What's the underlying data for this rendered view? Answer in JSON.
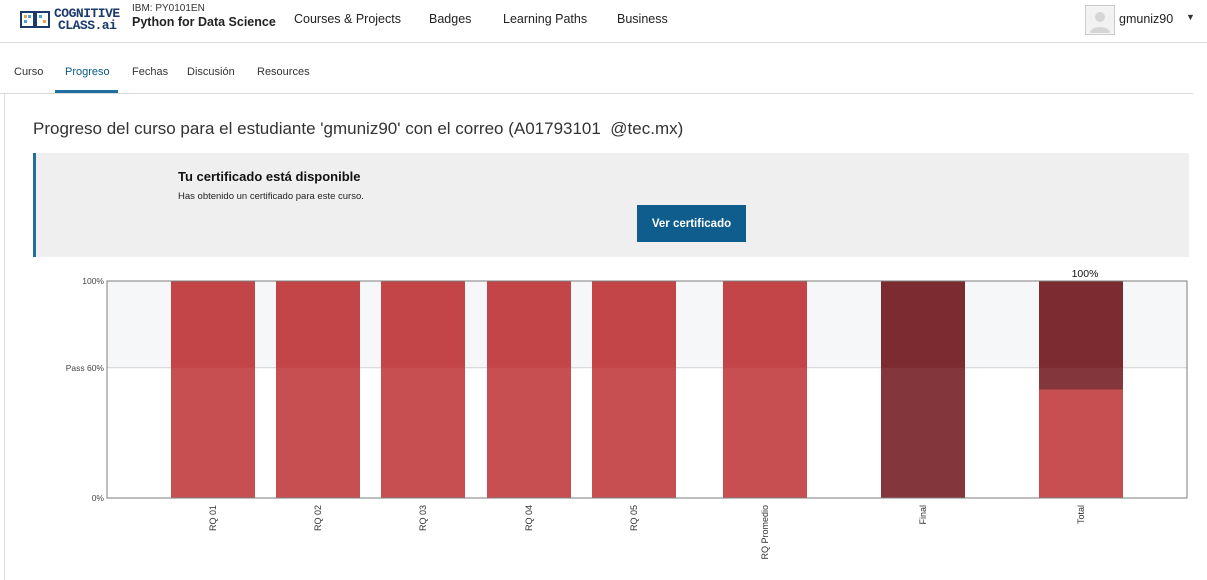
{
  "header": {
    "logo_line1": "COGNITIVE",
    "logo_line2": "CLASS.ai",
    "course_code": "IBM: PY0101EN",
    "course_name": "Python for Data Science",
    "nav": [
      "Courses & Projects",
      "Badges",
      "Learning Paths",
      "Business"
    ],
    "user": "gmuniz90"
  },
  "tabs": [
    "Curso",
    "Progreso",
    "Fechas",
    "Discusión",
    "Resources"
  ],
  "active_tab": "Progreso",
  "page_title": "Progreso del curso para el estudiante 'gmuniz90' con el correo (A01793101  @tec.mx)",
  "certificate": {
    "title": "Tu certificado está disponible",
    "subtitle": "Has obtenido un certificado para este curso.",
    "button": "Ver certificado"
  },
  "colors": {
    "accent": "#1f6f9f",
    "bar": "#c44548",
    "bar_final": "#7c2b30"
  },
  "chart_data": {
    "type": "bar",
    "categories": [
      "RQ 01",
      "RQ 02",
      "RQ 03",
      "RQ 04",
      "RQ 05",
      "RQ Promedio",
      "Final",
      "Total"
    ],
    "values": [
      100,
      100,
      100,
      100,
      100,
      100,
      100,
      100
    ],
    "total_breakdown": [
      50,
      50
    ],
    "ylim": [
      0,
      100
    ],
    "y_ticks": [
      "0%",
      "Pass 60%",
      "100%"
    ],
    "pass_threshold": 60,
    "annotation": "100%"
  }
}
